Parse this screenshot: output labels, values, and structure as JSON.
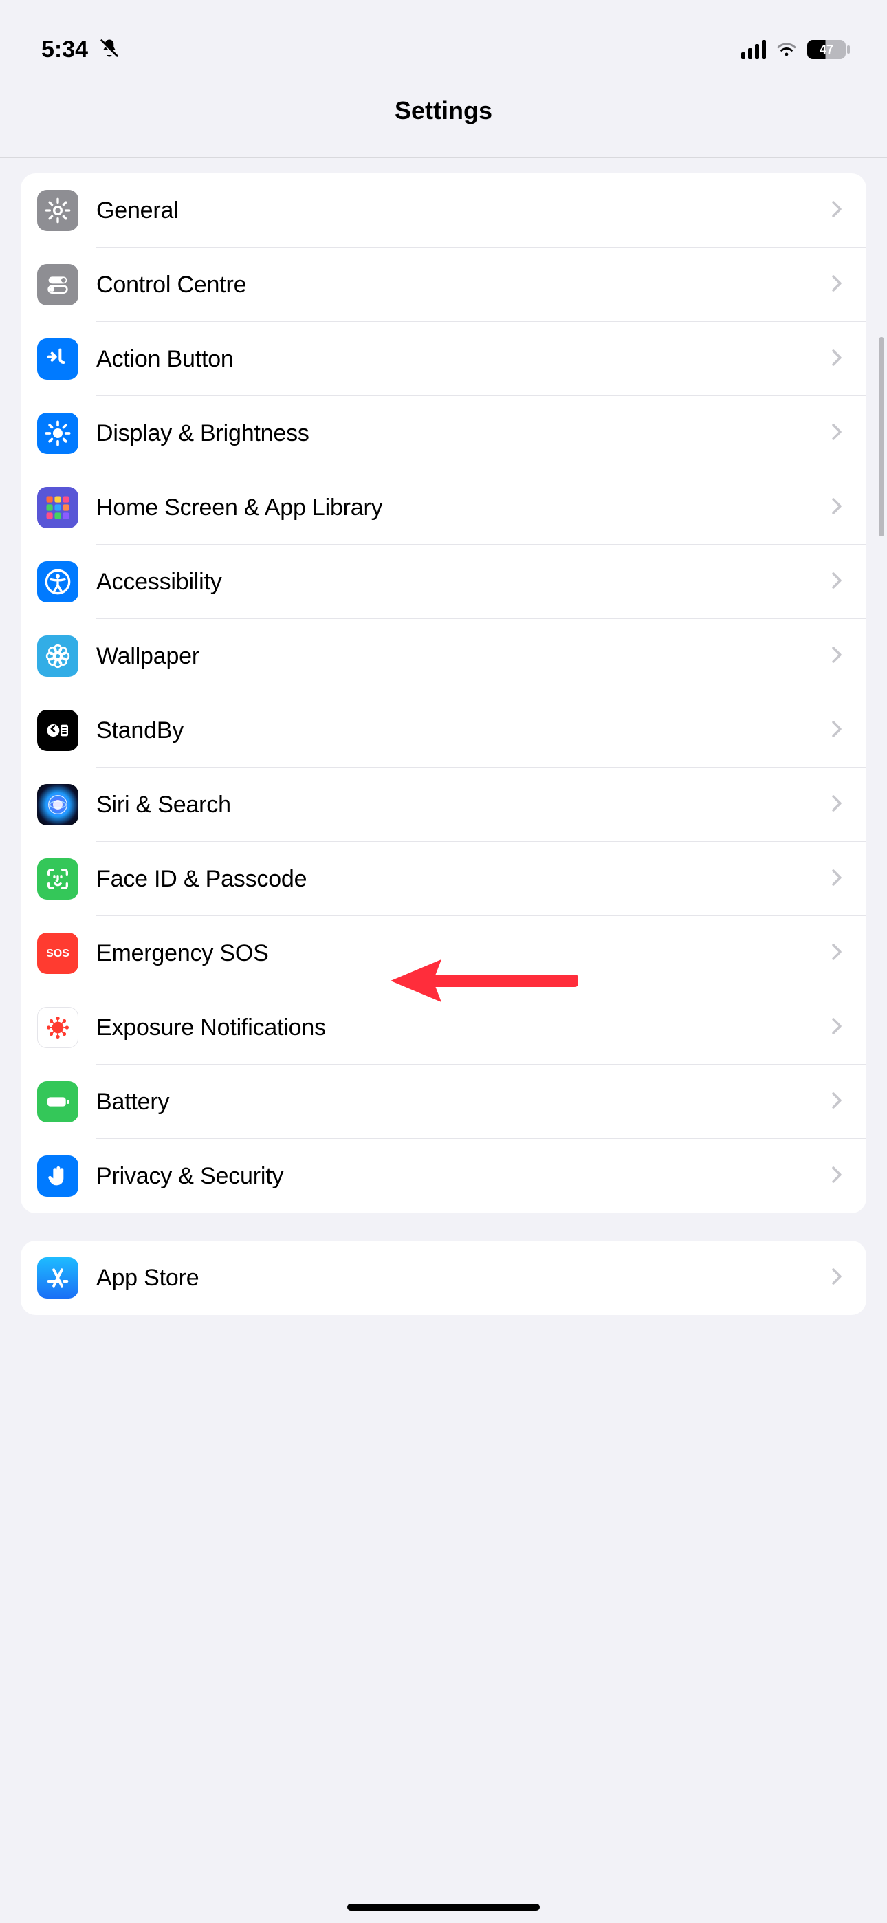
{
  "statusbar": {
    "time": "5:34",
    "silent": true,
    "battery_percent": "47"
  },
  "nav": {
    "title": "Settings"
  },
  "annotations": {
    "arrow_target_row_id": "face-id"
  },
  "groups": [
    {
      "rows": [
        {
          "id": "general",
          "label": "General",
          "icon": "gear",
          "bg": "bg-gray"
        },
        {
          "id": "control-centre",
          "label": "Control Centre",
          "icon": "toggles",
          "bg": "bg-gray"
        },
        {
          "id": "action-button",
          "label": "Action Button",
          "icon": "action-btn",
          "bg": "bg-blue"
        },
        {
          "id": "display",
          "label": "Display & Brightness",
          "icon": "sun",
          "bg": "bg-blue"
        },
        {
          "id": "home-screen",
          "label": "Home Screen & App Library",
          "icon": "apps-grid",
          "bg": "bg-purple"
        },
        {
          "id": "accessibility",
          "label": "Accessibility",
          "icon": "accessibility",
          "bg": "bg-blue"
        },
        {
          "id": "wallpaper",
          "label": "Wallpaper",
          "icon": "flower",
          "bg": "bg-lblue"
        },
        {
          "id": "standby",
          "label": "StandBy",
          "icon": "standby",
          "bg": "bg-black"
        },
        {
          "id": "siri",
          "label": "Siri & Search",
          "icon": "siri",
          "bg": "bg-siri"
        },
        {
          "id": "face-id",
          "label": "Face ID & Passcode",
          "icon": "faceid",
          "bg": "bg-green"
        },
        {
          "id": "emergency-sos",
          "label": "Emergency SOS",
          "icon": "sos",
          "bg": "bg-red"
        },
        {
          "id": "exposure",
          "label": "Exposure Notifications",
          "icon": "virus",
          "bg": "bg-white"
        },
        {
          "id": "battery",
          "label": "Battery",
          "icon": "battery",
          "bg": "bg-green"
        },
        {
          "id": "privacy",
          "label": "Privacy & Security",
          "icon": "hand",
          "bg": "bg-blue"
        }
      ]
    },
    {
      "rows": [
        {
          "id": "app-store",
          "label": "App Store",
          "icon": "appstore",
          "bg": "bg-store"
        }
      ]
    }
  ]
}
